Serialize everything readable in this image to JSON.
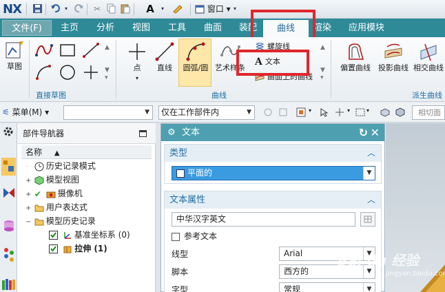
{
  "app": {
    "logo": "NX",
    "window_menu": "窗口"
  },
  "menubar": {
    "file": "文件(F)",
    "items": [
      "主页",
      "分析",
      "视图",
      "工具",
      "曲面",
      "装配",
      "曲线",
      "渲染",
      "应用模块"
    ],
    "active": "曲线"
  },
  "ribbon": {
    "groups": {
      "direct_sketch": "直接草图",
      "curve": "曲线",
      "derived": "派生曲线"
    },
    "buttons": {
      "sketch": "草图",
      "point": "点",
      "line": "直线",
      "arc": "圆弧/圆",
      "art_spline": "艺术样条",
      "helix": "螺旋线",
      "text": "文本",
      "curve_on_surface": "曲面上的曲线",
      "offset_curve": "偏置曲线",
      "project_curve": "投影曲线",
      "intersect_curve": "相交曲线"
    }
  },
  "selection_bar": {
    "menu": "菜单(M)",
    "filter_value": "",
    "scope": "仅在工作部件内",
    "cut_plane": "相切面"
  },
  "navigator": {
    "title": "部件导航器",
    "column": "名称",
    "rows": [
      {
        "label": "历史记录模式",
        "icon": "clock-icon"
      },
      {
        "label": "模型视图",
        "icon": "model-view-icon"
      },
      {
        "label": "摄像机",
        "icon": "camera-icon"
      },
      {
        "label": "用户表达式",
        "icon": "folder-icon"
      },
      {
        "label": "模型历史记录",
        "icon": "folder-icon"
      },
      {
        "label": "基准坐标系 (0)",
        "icon": "csys-icon"
      },
      {
        "label": "拉伸 (1)",
        "icon": "extrude-icon"
      }
    ]
  },
  "dialog": {
    "title": "文本",
    "type_section": "类型",
    "type_value": "平面的",
    "props_section": "文本属性",
    "text_value": "中华汉字英文",
    "ref_text": "参考文本",
    "line_type_label": "线型",
    "line_type_value": "Arial",
    "script_label": "脚本",
    "script_value": "西方的",
    "style_label": "字型",
    "style_value": "常规"
  },
  "watermark": {
    "brand": "Bai du 经验",
    "sub": "jingyan.baidu.com"
  },
  "colors": {
    "menubar": "#2f8a98",
    "dialog_title": "#4ea0b0",
    "highlight": "#e0262c",
    "section": "#1f6ea3"
  }
}
